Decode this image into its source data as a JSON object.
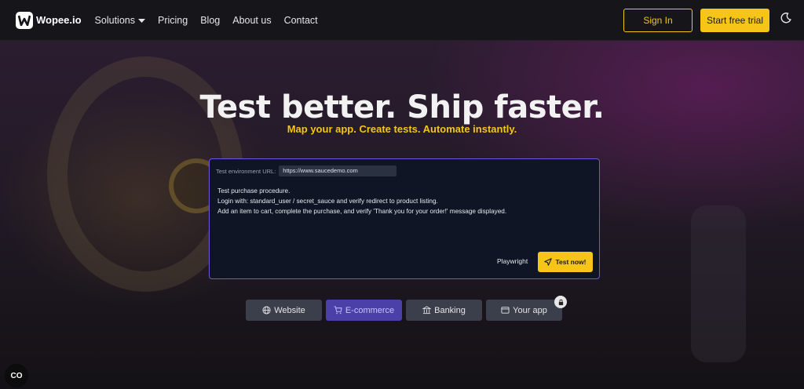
{
  "header": {
    "logo_text": "Wopee.io",
    "nav": [
      {
        "label": "Solutions",
        "has_dropdown": true
      },
      {
        "label": "Pricing"
      },
      {
        "label": "Blog"
      },
      {
        "label": "About us"
      },
      {
        "label": "Contact"
      }
    ],
    "signin_label": "Sign In",
    "trial_label": "Start free trial",
    "theme_icon": "moon-icon"
  },
  "hero": {
    "title": "Test better. Ship faster.",
    "subtitle": "Map your app. Create tests. Automate instantly."
  },
  "card": {
    "url_label": "Test environment URL:",
    "url_value": "https://www.saucedemo.com",
    "prompt_lines": [
      "Test purchase procedure.",
      "Login with: standard_user / secret_sauce and verify redirect to product listing.",
      "Add an item to cart, complete the purchase, and verify 'Thank you for your order!' message displayed."
    ],
    "framework_label": "Playwright",
    "test_button_label": "Test now!"
  },
  "chips": [
    {
      "label": "Website",
      "icon": "globe-icon",
      "active": false
    },
    {
      "label": "E-commerce",
      "icon": "cart-icon",
      "active": true
    },
    {
      "label": "Banking",
      "icon": "bank-icon",
      "active": false
    },
    {
      "label": "Your app",
      "icon": "window-icon",
      "active": false
    }
  ],
  "corner_badge": "CO",
  "colors": {
    "accent": "#f5c518",
    "card_border": "#6f58d8",
    "active_chip": "#4b3fa8"
  }
}
